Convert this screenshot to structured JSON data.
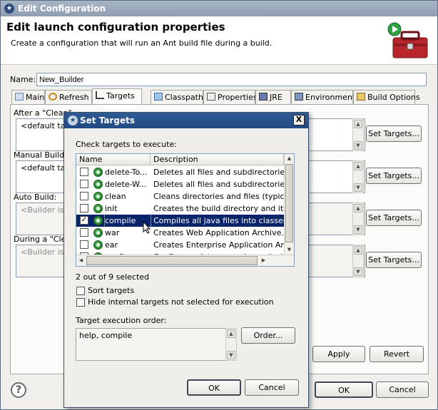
{
  "window": {
    "title": "Edit Configuration",
    "header_title": "Edit launch configuration properties",
    "header_desc": "Create a configuration that will run an Ant build file during a build."
  },
  "name_field": {
    "label": "Name:",
    "value": "New_Builder"
  },
  "tabs": [
    {
      "label": "Main",
      "icon": "main-tab-icon"
    },
    {
      "label": "Refresh",
      "icon": "refresh-icon"
    },
    {
      "label": "Targets",
      "icon": "targets-icon"
    },
    {
      "label": "Classpath",
      "icon": "classpath-icon"
    },
    {
      "label": "Properties",
      "icon": "properties-icon"
    },
    {
      "label": "JRE",
      "icon": "jre-icon"
    },
    {
      "label": "Environment",
      "icon": "environment-icon"
    },
    {
      "label": "Build Options",
      "icon": "build-options-icon"
    }
  ],
  "sections": [
    {
      "label": "After a \"Clean\"",
      "value": "<default targ",
      "set_button": "Set Targets..."
    },
    {
      "label": "Manual Build:",
      "value": "<default targ",
      "set_button": "Set Targets..."
    },
    {
      "label": "Auto Build:",
      "value": "<Builder is no",
      "set_button": "Set Targets..."
    },
    {
      "label": "During a \"Clea",
      "value": "<Builder is no",
      "set_button": "Set Targets..."
    }
  ],
  "footer": {
    "apply": "Apply",
    "revert": "Revert",
    "ok": "OK",
    "cancel": "Cancel"
  },
  "dialog": {
    "title": "Set Targets",
    "close": "X",
    "check_label": "Check targets to execute:",
    "columns": [
      "Name",
      "Description"
    ],
    "rows": [
      {
        "name": "delete-To...",
        "description": "Deletes all files and subdirectories of .",
        "checked": false,
        "selected": false
      },
      {
        "name": "delete-W...",
        "description": "Deletes all files and subdirectories of .",
        "checked": false,
        "selected": false
      },
      {
        "name": "clean",
        "description": "Cleans directories and files (typically .",
        "checked": false,
        "selected": false
      },
      {
        "name": "init",
        "description": "Creates the build directory and its chil",
        "checked": false,
        "selected": false
      },
      {
        "name": "compile",
        "description": "Compiles all java files into classes (by",
        "checked": true,
        "selected": true
      },
      {
        "name": "war",
        "description": "Creates Web Application Archive.",
        "checked": false,
        "selected": false
      },
      {
        "name": "ear",
        "description": "Creates Enterprise Application Archive",
        "checked": false,
        "selected": false
      },
      {
        "name": "configure",
        "description": "Configures datasource by replacing to",
        "checked": false,
        "selected": false
      }
    ],
    "selected_count": "2 out of 9 selected",
    "sort_targets": "Sort targets",
    "hide_internal": "Hide internal targets not selected for execution",
    "order_label": "Target execution order:",
    "order_value": "help, compile",
    "order_button": "Order...",
    "ok": "OK",
    "cancel": "Cancel"
  },
  "colors": {
    "selection": "#0a246a",
    "dialog_title": "#204a82"
  }
}
